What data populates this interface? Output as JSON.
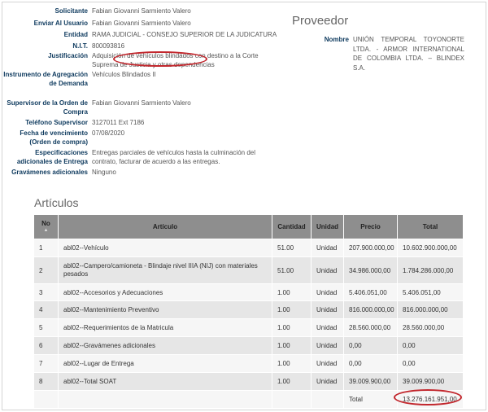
{
  "fields": [
    {
      "label": "Solicitante",
      "value": "Fabian Giovanni Sarmiento Valero"
    },
    {
      "label": "Enviar Al Usuario",
      "value": "Fabian Giovanni Sarmiento Valero"
    },
    {
      "label": "Entidad",
      "value": "RAMA JUDICIAL - CONSEJO SUPERIOR DE LA JUDICATURA"
    },
    {
      "label": "N.I.T.",
      "value": "800093816"
    },
    {
      "label": "Justificación",
      "value": "Adquisición de vehículos blindados con destino a la Corte Suprema de Justicia y otras dependencias"
    },
    {
      "label": "Instrumento de Agregación de Demanda",
      "value": "Vehículos Blindados II"
    },
    {
      "label": "Supervisor de la Orden de Compra",
      "value": "Fabian Giovanni Sarmiento Valero"
    },
    {
      "label": "Teléfono Supervisor",
      "value": "3127011 Ext 7186"
    },
    {
      "label": "Fecha de vencimiento (Orden de compra)",
      "value": "07/08/2020"
    },
    {
      "label": "Especificaciones adicionales de Entrega",
      "value": "Entregas parciales de vehículos hasta la culminación del contrato, facturar de acuerdo a las entregas."
    },
    {
      "label": "Gravámenes adicionales",
      "value": "Ninguno"
    }
  ],
  "proveedor": {
    "title": "Proveedor",
    "label": "Nombre",
    "value": "UNIÓN TEMPORAL TOYONORTE LTDA. - ARMOR INTERNATIONAL DE COLOMBIA LTDA. – BLINDEX S.A."
  },
  "articulos": {
    "title": "Artículos",
    "headers": {
      "no": "No",
      "sort": "▲",
      "articulo": "Artículo",
      "cantidad": "Cantidad",
      "unidad": "Unidad",
      "precio": "Precio",
      "total": "Total"
    },
    "rows": [
      {
        "no": "1",
        "articulo": "abl02--Vehículo",
        "cantidad": "51.00",
        "unidad": "Unidad",
        "precio": "207.900.000,00",
        "total": "10.602.900.000,00"
      },
      {
        "no": "2",
        "articulo": "abl02--Campero/camioneta - Blindaje nivel IIIA (NIJ) con materiales pesados",
        "cantidad": "51.00",
        "unidad": "Unidad",
        "precio": "34.986.000,00",
        "total": "1.784.286.000,00"
      },
      {
        "no": "3",
        "articulo": "abl02--Accesorios y Adecuaciones",
        "cantidad": "1.00",
        "unidad": "Unidad",
        "precio": "5.406.051,00",
        "total": "5.406.051,00"
      },
      {
        "no": "4",
        "articulo": "abl02--Mantenimiento Preventivo",
        "cantidad": "1.00",
        "unidad": "Unidad",
        "precio": "816.000.000,00",
        "total": "816.000.000,00"
      },
      {
        "no": "5",
        "articulo": "abl02--Requerimientos de la Matricula",
        "cantidad": "1.00",
        "unidad": "Unidad",
        "precio": "28.560.000,00",
        "total": "28.560.000,00"
      },
      {
        "no": "6",
        "articulo": "abl02--Gravámenes adicionales",
        "cantidad": "1.00",
        "unidad": "Unidad",
        "precio": "0,00",
        "total": "0,00"
      },
      {
        "no": "7",
        "articulo": "abl02--Lugar de Entrega",
        "cantidad": "1.00",
        "unidad": "Unidad",
        "precio": "0,00",
        "total": "0,00"
      },
      {
        "no": "8",
        "articulo": "abl02--Total SOAT",
        "cantidad": "1.00",
        "unidad": "Unidad",
        "precio": "39.009.900,00",
        "total": "39.009.900,00"
      }
    ],
    "total_label": "Total",
    "total_value": "13.276.161.951,00"
  },
  "colors": {
    "label": "#0e3a5e",
    "header_bg": "#8e8e8e",
    "annotation": "#c2272d"
  }
}
